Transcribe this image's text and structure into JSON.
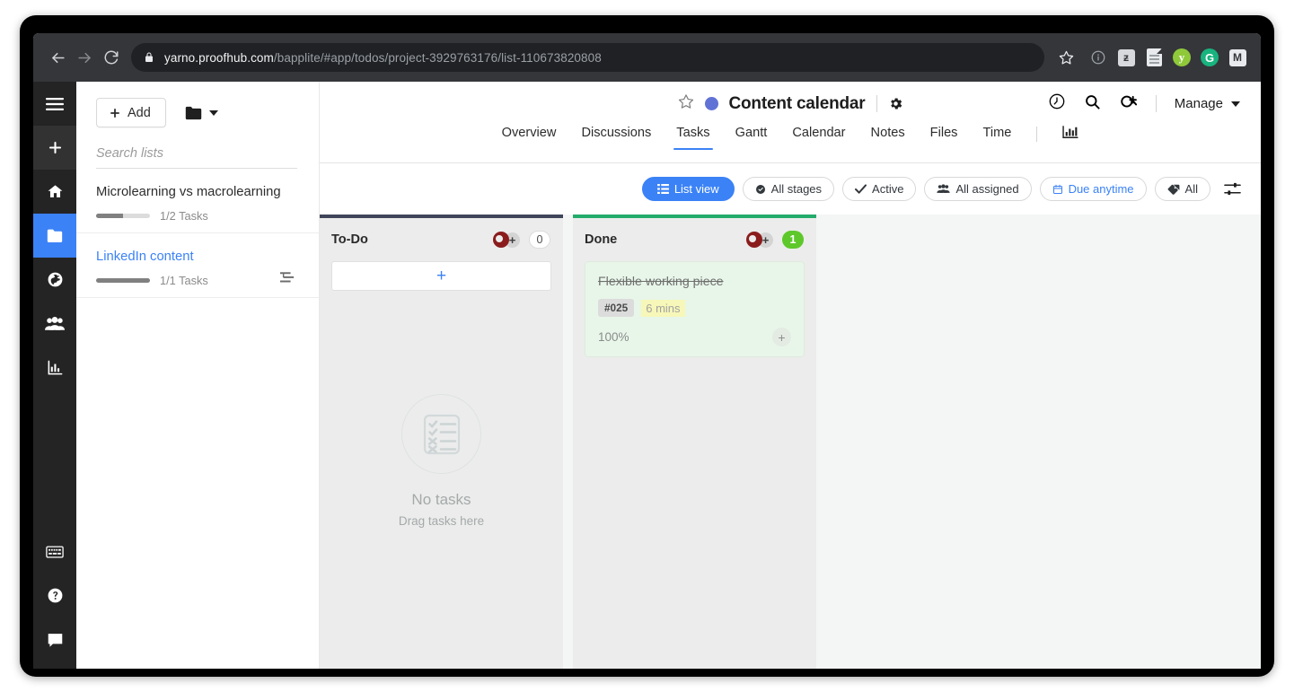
{
  "browser": {
    "back_icon": "arrow-left-icon",
    "forward_icon": "arrow-right-icon",
    "reload_icon": "reload-icon",
    "lock_icon": "lock-icon",
    "url_host": "yarno.proofhub.com",
    "url_path": "/bapplite/#app/todos/project-3929763176/list-110673820808",
    "bookmark_icon": "star-icon",
    "extensions": [
      {
        "name": "page-info-icon",
        "label": ""
      },
      {
        "name": "extension-tile-icon",
        "label": "ƕ"
      },
      {
        "name": "document-extension-icon",
        "label": ""
      },
      {
        "name": "yarno-extension-icon",
        "label": "y"
      },
      {
        "name": "grammarly-extension-icon",
        "label": "G"
      },
      {
        "name": "mail-extension-icon",
        "label": "M"
      }
    ]
  },
  "rail": {
    "items": [
      {
        "name": "menu-icon",
        "label": "Menu"
      },
      {
        "name": "add-icon",
        "label": "Add"
      },
      {
        "name": "home-icon",
        "label": "Home"
      },
      {
        "name": "projects-folder-icon",
        "label": "Projects"
      },
      {
        "name": "globe-icon",
        "label": "Everything"
      },
      {
        "name": "people-icon",
        "label": "People"
      },
      {
        "name": "reports-chart-icon",
        "label": "Reports"
      }
    ],
    "bottom_items": [
      {
        "name": "keyboard-icon",
        "label": "Keyboard shortcuts"
      },
      {
        "name": "help-icon",
        "label": "Help"
      },
      {
        "name": "chat-icon",
        "label": "Chat"
      }
    ]
  },
  "header": {
    "star_icon": "star-outline-icon",
    "project_dot_color": "#6172d6",
    "project_title": "Content calendar",
    "settings_icon": "gear-icon",
    "timer_icon": "clock-timer-icon",
    "search_icon": "search-icon",
    "add_people_icon": "add-user-icon",
    "manage_label": "Manage",
    "manage_caret": "chevron-down-icon"
  },
  "tabs": [
    {
      "label": "Overview",
      "active": false
    },
    {
      "label": "Discussions",
      "active": false
    },
    {
      "label": "Tasks",
      "active": true
    },
    {
      "label": "Gantt",
      "active": false
    },
    {
      "label": "Calendar",
      "active": false
    },
    {
      "label": "Notes",
      "active": false
    },
    {
      "label": "Files",
      "active": false
    },
    {
      "label": "Time",
      "active": false
    }
  ],
  "tabs_chart_icon": "bar-chart-icon",
  "sidebar": {
    "add_button": "Add",
    "folder_icon": "folder-icon",
    "folder_caret": "chevron-down-icon",
    "search_placeholder": "Search lists",
    "search_value": "",
    "lists": [
      {
        "name": "Microlearning vs macrolearning",
        "count": "1/2 Tasks",
        "progress": 50,
        "active": false
      },
      {
        "name": "LinkedIn content",
        "count": "1/1 Tasks",
        "progress": 100,
        "active": true
      }
    ]
  },
  "toolbar": {
    "filters": [
      {
        "label": "List view",
        "icon": "list-view-icon",
        "style": "primary"
      },
      {
        "label": "All stages",
        "icon": "check-circle-icon",
        "style": "default"
      },
      {
        "label": "Active",
        "icon": "check-icon",
        "style": "default"
      },
      {
        "label": "All assigned",
        "icon": "people-icon",
        "style": "default"
      },
      {
        "label": "Due anytime",
        "icon": "calendar-icon",
        "style": "blue-text"
      },
      {
        "label": "All",
        "icon": "tag-icon",
        "style": "default"
      }
    ],
    "settings_icon": "sliders-icon"
  },
  "board": {
    "columns": [
      {
        "title": "To-Do",
        "color": "#40455a",
        "count": "0",
        "count_style": "plain",
        "assign_icon": "avatar-add-icon",
        "add_card_label": "+",
        "empty": {
          "icon": "checklist-empty-icon",
          "title": "No tasks",
          "subtitle": "Drag tasks here"
        },
        "tasks": []
      },
      {
        "title": "Done",
        "color": "#22ab6b",
        "count": "1",
        "count_style": "green",
        "assign_icon": "avatar-add-icon",
        "tasks": [
          {
            "title": "Flexible working piece",
            "completed": true,
            "id_badge": "#025",
            "time_badge": "6 mins",
            "progress": "100%",
            "add_icon": "plus-icon"
          }
        ]
      }
    ]
  }
}
